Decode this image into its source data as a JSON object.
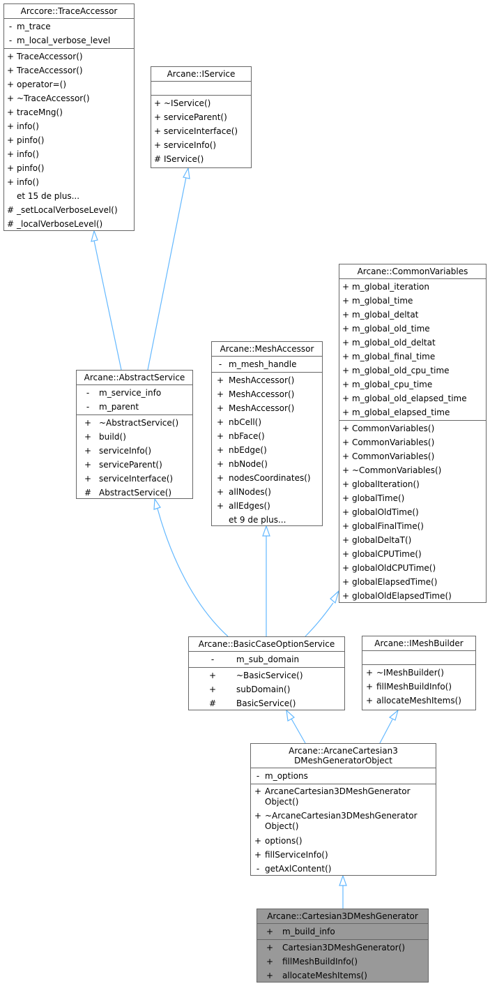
{
  "diagram": {
    "type": "class-inheritance",
    "edge_color": "#63b8ff",
    "border_color": "#666666",
    "current_fill": "#999999",
    "nodes": {
      "trace_accessor": {
        "title": "Arccore::TraceAccessor",
        "attributes": [
          {
            "vis": "-",
            "name": "m_trace"
          },
          {
            "vis": "-",
            "name": "m_local_verbose_level"
          }
        ],
        "methods": [
          {
            "vis": "+",
            "name": "TraceAccessor()"
          },
          {
            "vis": "+",
            "name": "TraceAccessor()"
          },
          {
            "vis": "+",
            "name": "operator=()"
          },
          {
            "vis": "+",
            "name": "~TraceAccessor()"
          },
          {
            "vis": "+",
            "name": "traceMng()"
          },
          {
            "vis": "+",
            "name": "info()"
          },
          {
            "vis": "+",
            "name": "pinfo()"
          },
          {
            "vis": "+",
            "name": "info()"
          },
          {
            "vis": "+",
            "name": "pinfo()"
          },
          {
            "vis": "+",
            "name": "info()"
          },
          {
            "vis": "",
            "name": "et 15 de plus..."
          },
          {
            "vis": "#",
            "name": "_setLocalVerboseLevel()"
          },
          {
            "vis": "#",
            "name": "_localVerboseLevel()"
          }
        ]
      },
      "iservice": {
        "title": "Arcane::IService",
        "attributes": [],
        "methods": [
          {
            "vis": "+",
            "name": "~IService()"
          },
          {
            "vis": "+",
            "name": "serviceParent()"
          },
          {
            "vis": "+",
            "name": "serviceInterface()"
          },
          {
            "vis": "+",
            "name": "serviceInfo()"
          },
          {
            "vis": "#",
            "name": "IService()"
          }
        ]
      },
      "common_variables": {
        "title": "Arcane::CommonVariables",
        "attributes": [
          {
            "vis": "+",
            "name": "m_global_iteration"
          },
          {
            "vis": "+",
            "name": "m_global_time"
          },
          {
            "vis": "+",
            "name": "m_global_deltat"
          },
          {
            "vis": "+",
            "name": "m_global_old_time"
          },
          {
            "vis": "+",
            "name": "m_global_old_deltat"
          },
          {
            "vis": "+",
            "name": "m_global_final_time"
          },
          {
            "vis": "+",
            "name": "m_global_old_cpu_time"
          },
          {
            "vis": "+",
            "name": "m_global_cpu_time"
          },
          {
            "vis": "+",
            "name": "m_global_old_elapsed_time"
          },
          {
            "vis": "+",
            "name": "m_global_elapsed_time"
          }
        ],
        "methods": [
          {
            "vis": "+",
            "name": "CommonVariables()"
          },
          {
            "vis": "+",
            "name": "CommonVariables()"
          },
          {
            "vis": "+",
            "name": "CommonVariables()"
          },
          {
            "vis": "+",
            "name": "~CommonVariables()"
          },
          {
            "vis": "+",
            "name": "globalIteration()"
          },
          {
            "vis": "+",
            "name": "globalTime()"
          },
          {
            "vis": "+",
            "name": "globalOldTime()"
          },
          {
            "vis": "+",
            "name": "globalFinalTime()"
          },
          {
            "vis": "+",
            "name": "globalDeltaT()"
          },
          {
            "vis": "+",
            "name": "globalCPUTime()"
          },
          {
            "vis": "+",
            "name": "globalOldCPUTime()"
          },
          {
            "vis": "+",
            "name": "globalElapsedTime()"
          },
          {
            "vis": "+",
            "name": "globalOldElapsedTime()"
          }
        ]
      },
      "mesh_accessor": {
        "title": "Arcane::MeshAccessor",
        "attributes": [
          {
            "vis": "-",
            "name": "m_mesh_handle"
          }
        ],
        "methods": [
          {
            "vis": "+",
            "name": "MeshAccessor()"
          },
          {
            "vis": "+",
            "name": "MeshAccessor()"
          },
          {
            "vis": "+",
            "name": "MeshAccessor()"
          },
          {
            "vis": "+",
            "name": "nbCell()"
          },
          {
            "vis": "+",
            "name": "nbFace()"
          },
          {
            "vis": "+",
            "name": "nbEdge()"
          },
          {
            "vis": "+",
            "name": "nbNode()"
          },
          {
            "vis": "+",
            "name": "nodesCoordinates()"
          },
          {
            "vis": "+",
            "name": "allNodes()"
          },
          {
            "vis": "+",
            "name": "allEdges()"
          },
          {
            "vis": "",
            "name": "et 9 de plus..."
          }
        ]
      },
      "abstract_service": {
        "title": "Arcane::AbstractService",
        "attributes": [
          {
            "vis": "-",
            "name": "m_service_info"
          },
          {
            "vis": "-",
            "name": "m_parent"
          }
        ],
        "methods": [
          {
            "vis": "+",
            "name": "~AbstractService()"
          },
          {
            "vis": "+",
            "name": "build()"
          },
          {
            "vis": "+",
            "name": "serviceInfo()"
          },
          {
            "vis": "+",
            "name": "serviceParent()"
          },
          {
            "vis": "+",
            "name": "serviceInterface()"
          },
          {
            "vis": "#",
            "name": "AbstractService()"
          }
        ]
      },
      "basic_case_option_service": {
        "title": "Arcane::BasicCaseOptionService",
        "attributes": [
          {
            "vis": "-",
            "name": "m_sub_domain"
          }
        ],
        "methods": [
          {
            "vis": "+",
            "name": "~BasicService()"
          },
          {
            "vis": "+",
            "name": "subDomain()"
          },
          {
            "vis": "#",
            "name": "BasicService()"
          }
        ]
      },
      "imesh_builder": {
        "title": "Arcane::IMeshBuilder",
        "attributes": [],
        "methods": [
          {
            "vis": "+",
            "name": "~IMeshBuilder()"
          },
          {
            "vis": "+",
            "name": "fillMeshBuildInfo()"
          },
          {
            "vis": "+",
            "name": "allocateMeshItems()"
          }
        ]
      },
      "arcane_cartesian_object": {
        "title": "Arcane::ArcaneCartesian3\nDMeshGeneratorObject",
        "attributes": [
          {
            "vis": "-",
            "name": "m_options"
          }
        ],
        "methods": [
          {
            "vis": "+",
            "name": "ArcaneCartesian3DMeshGenerator Object()"
          },
          {
            "vis": "+",
            "name": "~ArcaneCartesian3DMeshGenerator Object()"
          },
          {
            "vis": "+",
            "name": "options()"
          },
          {
            "vis": "+",
            "name": "fillServiceInfo()"
          },
          {
            "vis": "-",
            "name": "getAxlContent()"
          }
        ]
      },
      "cartesian_generator": {
        "title": "Arcane::Cartesian3DMeshGenerator",
        "current": true,
        "attributes": [
          {
            "vis": "+",
            "name": "m_build_info"
          }
        ],
        "methods": [
          {
            "vis": "+",
            "name": "Cartesian3DMeshGenerator()"
          },
          {
            "vis": "+",
            "name": "fillMeshBuildInfo()"
          },
          {
            "vis": "+",
            "name": "allocateMeshItems()"
          }
        ]
      }
    },
    "edges": [
      {
        "from": "abstract_service",
        "to": "trace_accessor"
      },
      {
        "from": "abstract_service",
        "to": "iservice"
      },
      {
        "from": "basic_case_option_service",
        "to": "abstract_service"
      },
      {
        "from": "basic_case_option_service",
        "to": "mesh_accessor"
      },
      {
        "from": "basic_case_option_service",
        "to": "common_variables"
      },
      {
        "from": "arcane_cartesian_object",
        "to": "basic_case_option_service"
      },
      {
        "from": "arcane_cartesian_object",
        "to": "imesh_builder"
      },
      {
        "from": "cartesian_generator",
        "to": "arcane_cartesian_object"
      }
    ]
  }
}
